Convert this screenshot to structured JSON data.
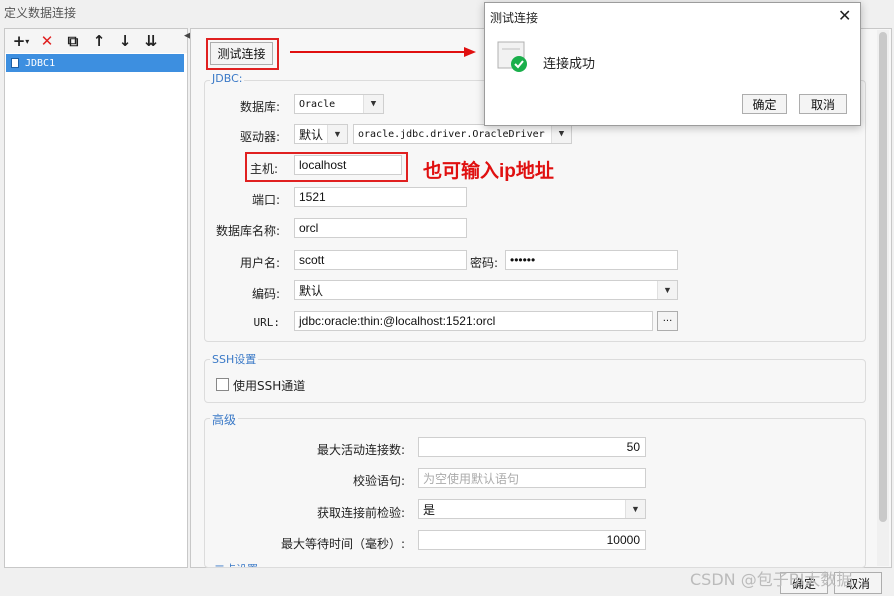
{
  "window": {
    "title": "定义数据连接"
  },
  "toolbar": {
    "add": "+",
    "add_dropdown": "▾",
    "delete": "✕",
    "copy": "⧉",
    "up": "↑",
    "down": "↓",
    "sort": "⇊"
  },
  "tree": {
    "items": [
      {
        "label": "JDBC1"
      }
    ]
  },
  "test_button": {
    "label": "测试连接"
  },
  "jdbc": {
    "section_title": "JDBC:",
    "database_label": "数据库:",
    "database_value": "Oracle",
    "driver_label": "驱动器:",
    "driver_mode": "默认",
    "driver_class": "oracle.jdbc.driver.OracleDriver",
    "host_label": "主机:",
    "host_value": "localhost",
    "port_label": "端口:",
    "port_value": "1521",
    "dbname_label": "数据库名称:",
    "dbname_value": "orcl",
    "user_label": "用户名:",
    "user_value": "scott",
    "password_label": "密码:",
    "password_value": "••••••",
    "encoding_label": "编码:",
    "encoding_value": "默认",
    "url_label": "URL:",
    "url_value": "jdbc:oracle:thin:@localhost:1521:orcl",
    "url_more": "···"
  },
  "ssh": {
    "section_title": "SSH设置",
    "checkbox_label": "使用SSH通道"
  },
  "advanced": {
    "section_title": "高级",
    "max_active_label": "最大活动连接数:",
    "max_active_value": "50",
    "validation_label": "校验语句:",
    "validation_placeholder": "为空使用默认语句",
    "test_before_label": "获取连接前检验:",
    "test_before_value": "是",
    "max_wait_label": "最大等待时间（毫秒）:",
    "max_wait_value": "10000",
    "next_section_partial": "二点设置"
  },
  "annotation": {
    "text": "也可输入ip地址"
  },
  "dialog": {
    "title": "测试连接",
    "close": "✕",
    "message": "连接成功",
    "ok": "确定",
    "cancel": "取消"
  },
  "footer": {
    "ok": "确定",
    "cancel": "取消"
  },
  "watermark": "CSDN @包子BI大数据",
  "colors": {
    "accent": "#3d8fe0",
    "annotation": "#e01010",
    "success": "#1aaf4b"
  }
}
